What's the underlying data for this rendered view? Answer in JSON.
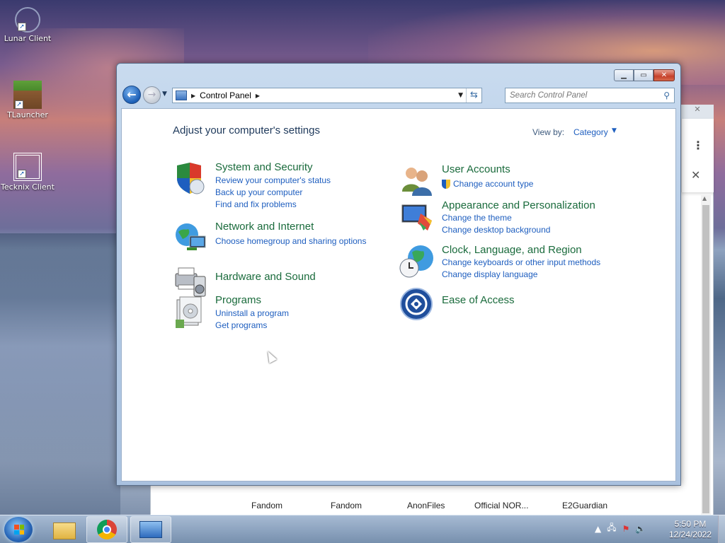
{
  "desktop": {
    "icons": [
      {
        "label": "Lunar Client",
        "icon": "lunar-client-icon"
      },
      {
        "label": "TLauncher",
        "icon": "minecraft-grass-block-icon"
      },
      {
        "label": "Tecknix Client",
        "icon": "tecknix-knot-icon"
      }
    ]
  },
  "browser_behind": {
    "bookmarks": [
      "Fandom",
      "Fandom",
      "AnonFiles",
      "Official NOR...",
      "E2Guardian"
    ]
  },
  "window": {
    "caption_buttons": {
      "minimize": "minimize-icon",
      "maximize": "maximize-icon",
      "close": "close-icon"
    },
    "address": {
      "crumb": "Control Panel"
    },
    "search": {
      "placeholder": "Search Control Panel"
    },
    "heading": "Adjust your computer's settings",
    "view_by": {
      "label": "View by:",
      "value": "Category"
    },
    "categories_left": [
      {
        "title": "System and Security",
        "icon": "shield-icon",
        "links": [
          "Review your computer's status",
          "Back up your computer",
          "Find and fix problems"
        ]
      },
      {
        "title": "Network and Internet",
        "icon": "network-globe-icon",
        "links": [
          "Choose homegroup and sharing options"
        ]
      },
      {
        "title": "Hardware and Sound",
        "icon": "printer-speaker-icon",
        "links": []
      },
      {
        "title": "Programs",
        "icon": "programs-box-icon",
        "links": [
          "Uninstall a program",
          "Get programs"
        ]
      }
    ],
    "categories_right": [
      {
        "title": "User Accounts",
        "icon": "users-icon",
        "links": [
          "Change account type"
        ]
      },
      {
        "title": "Appearance and Personalization",
        "icon": "monitor-paint-icon",
        "links": [
          "Change the theme",
          "Change desktop background"
        ]
      },
      {
        "title": "Clock, Language, and Region",
        "icon": "globe-clock-icon",
        "links": [
          "Change keyboards or other input methods",
          "Change display language"
        ]
      },
      {
        "title": "Ease of Access",
        "icon": "ease-of-access-icon",
        "links": []
      }
    ]
  },
  "taskbar": {
    "buttons": [
      "file-explorer-icon",
      "chrome-icon",
      "control-panel-icon"
    ],
    "clock": {
      "time": "5:50 PM",
      "date": "12/24/2022"
    }
  },
  "colors": {
    "link": "#1e5ebf",
    "category_title": "#1a6b3c",
    "heading": "#1e395b"
  }
}
